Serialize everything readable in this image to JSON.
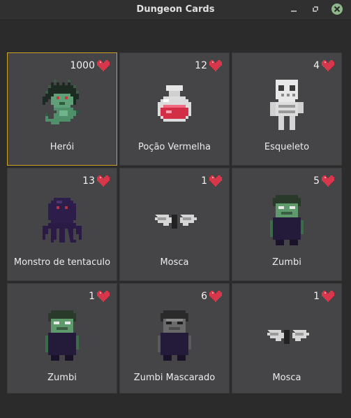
{
  "window": {
    "title": "Dungeon Cards"
  },
  "cards": [
    {
      "name": "Herói",
      "hp": "1000",
      "sprite": "medusa-hero"
    },
    {
      "name": "Poção Vermelha",
      "hp": "12",
      "sprite": "red-potion"
    },
    {
      "name": "Esqueleto",
      "hp": "4",
      "sprite": "skeleton"
    },
    {
      "name": "Monstro de tentaculo",
      "hp": "13",
      "sprite": "tentacle-monster"
    },
    {
      "name": "Mosca",
      "hp": "1",
      "sprite": "fly"
    },
    {
      "name": "Zumbi",
      "hp": "5",
      "sprite": "zombie"
    },
    {
      "name": "Zumbi",
      "hp": "1",
      "sprite": "zombie"
    },
    {
      "name": "Zumbi Mascarado",
      "hp": "6",
      "sprite": "masked-zombie"
    },
    {
      "name": "Mosca",
      "hp": "1",
      "sprite": "fly"
    }
  ],
  "colors": {
    "selected_border": "#c9a227",
    "heart": "#d8364a",
    "card_bg": "#454548"
  }
}
